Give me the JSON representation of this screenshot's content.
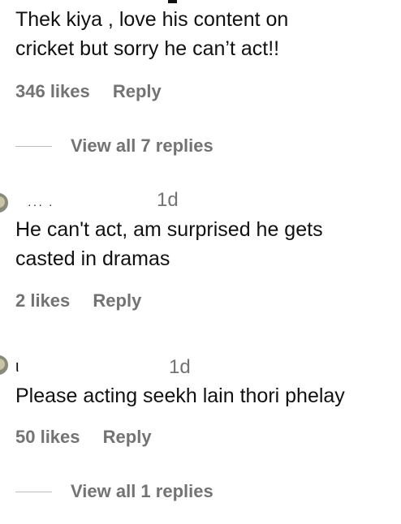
{
  "comments": [
    {
      "text": "Thek kiya , love his content on\ncricket but sorry he can’t act!!",
      "likes": "346 likes",
      "reply": "Reply",
      "view_replies": "View all 7 replies"
    },
    {
      "time": "1d",
      "text": "He can't act, am surprised he gets\ncasted in dramas",
      "likes": "2 likes",
      "reply": "Reply"
    },
    {
      "username_fragment": "ι",
      "time": "1d",
      "text": "Please acting seekh lain thori phelay",
      "likes": "50 likes",
      "reply": "Reply",
      "view_replies": "View all 1 replies"
    }
  ]
}
